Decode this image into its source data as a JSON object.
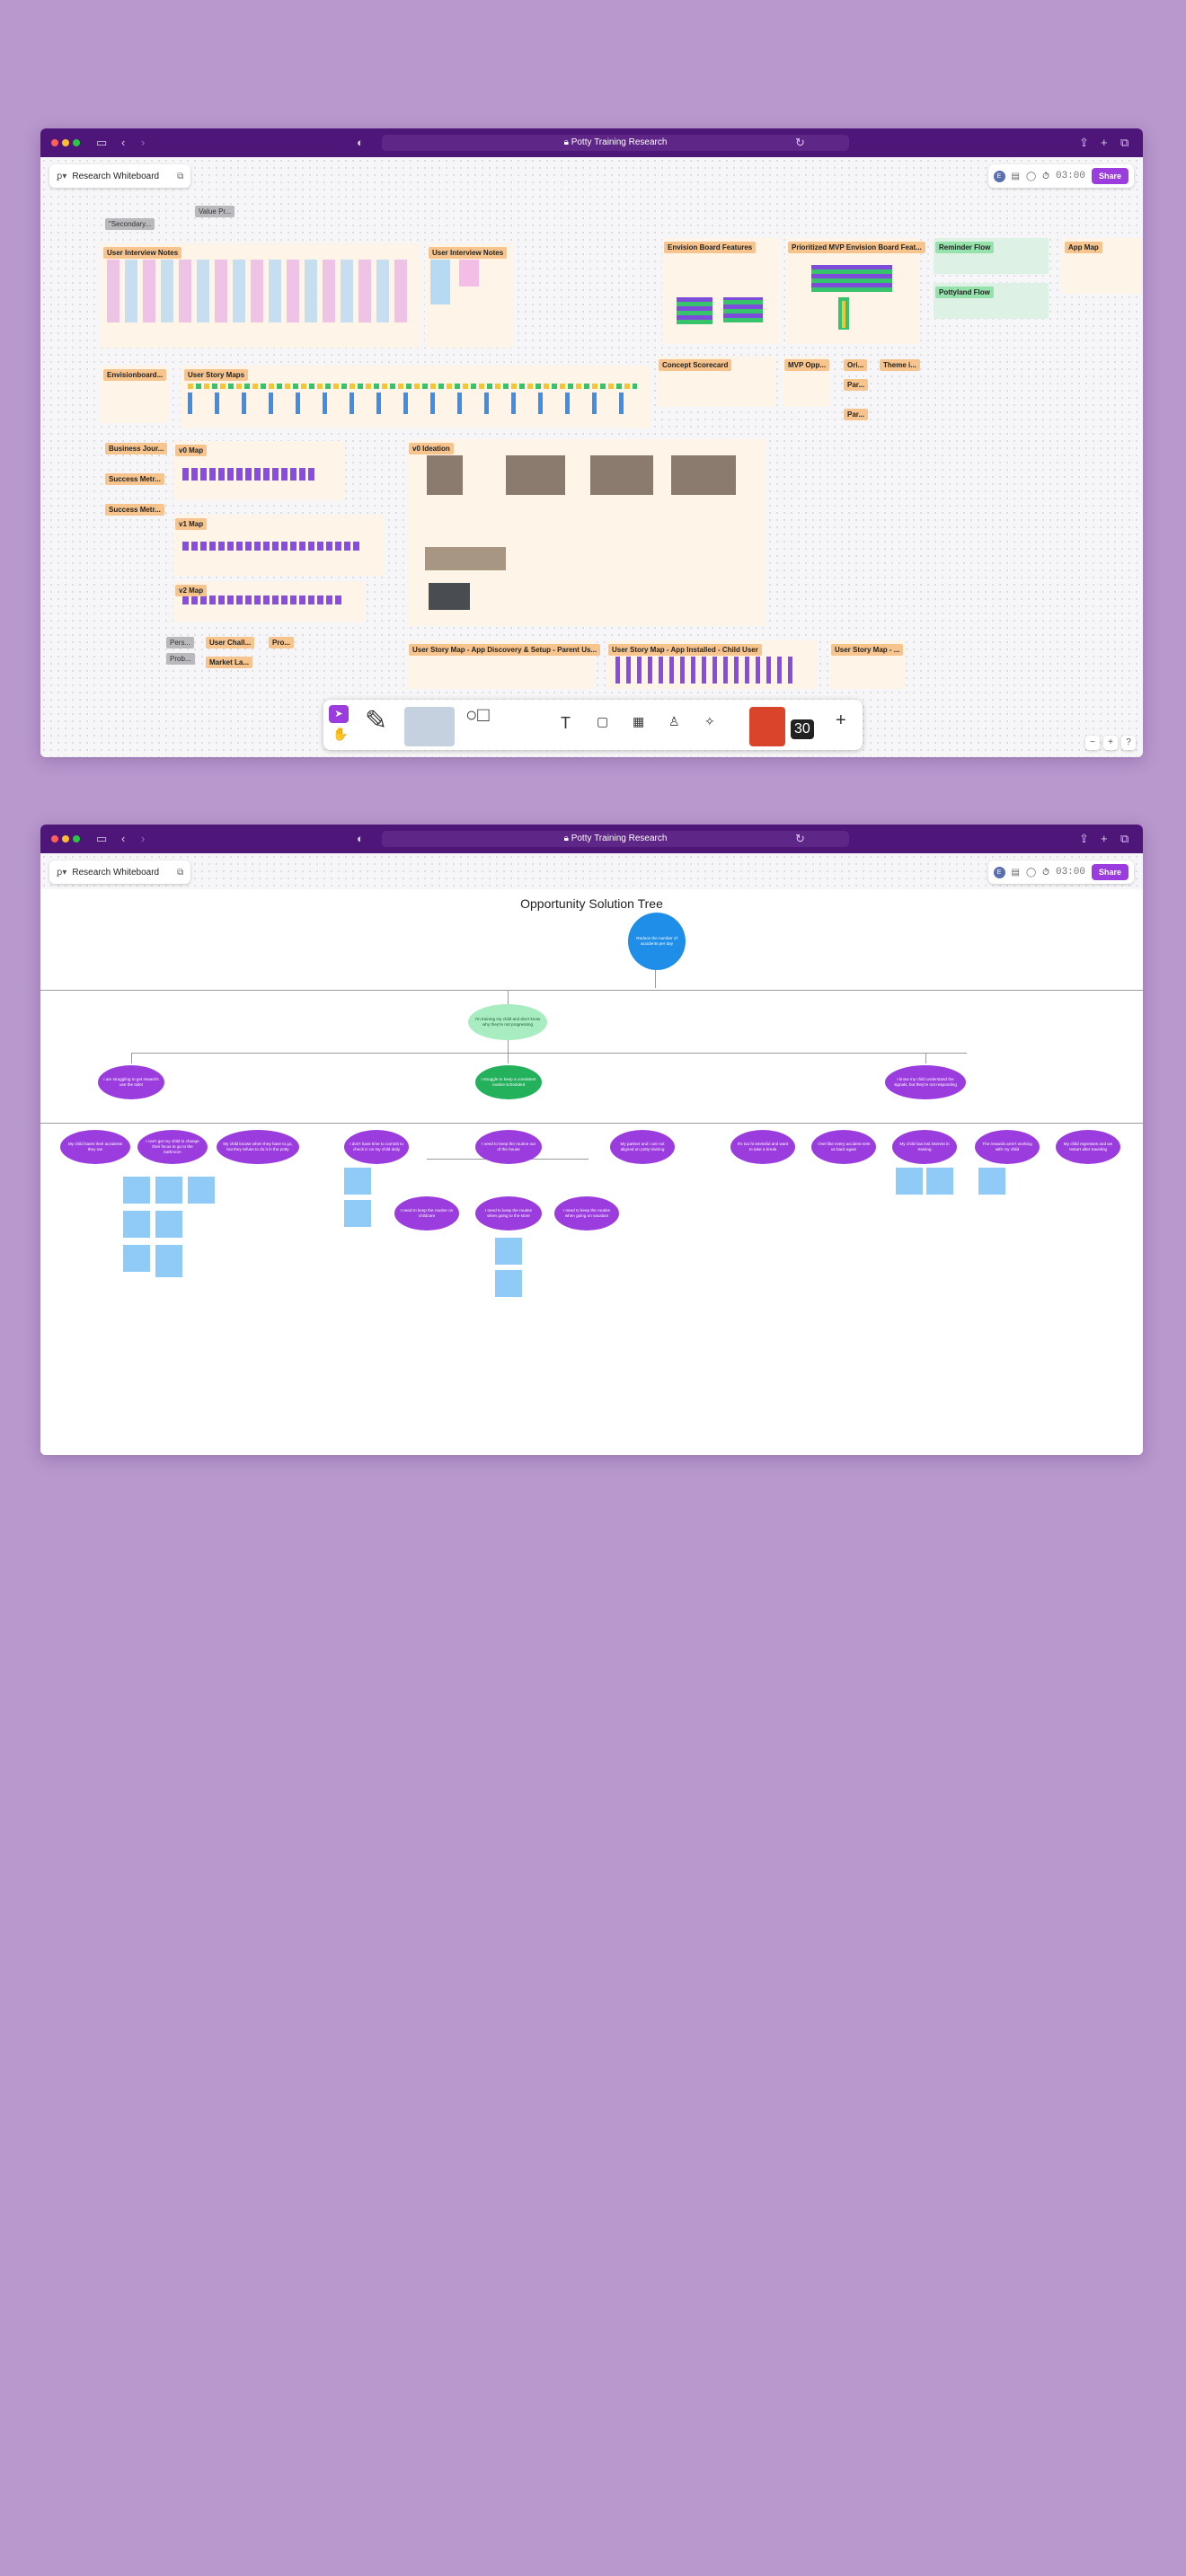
{
  "colors": {
    "background": "#b898cd",
    "titlebar": "#4d1678",
    "accent": "#9b3dde"
  },
  "window1": {
    "url": "Potty Training Research",
    "file_name": "Research Whiteboard",
    "avatar": "E",
    "timer": "03:00",
    "share": "Share",
    "sections": {
      "secondary": "\"Secondary...",
      "value_pr": "Value Pr...",
      "uin1": "User Interview Notes",
      "uin2": "User Interview Notes",
      "envision_feat": "Envision Board Features",
      "prio_mvp": "Prioritized MVP Envision Board Feat...",
      "reminder": "Reminder Flow",
      "pottyland": "Pottyland Flow",
      "appmap": "App Map",
      "envisionboard": "Envisionboard...",
      "usm": "User Story Maps",
      "concept": "Concept Scorecard",
      "mvp_opp": "MVP Opp...",
      "ori": "Ori...",
      "theme": "Theme i...",
      "par1": "Par...",
      "par2": "Par...",
      "business": "Business Jour...",
      "success1": "Success Metr...",
      "success2": "Success Metr...",
      "v0map": "v0 Map",
      "v1map": "v1 Map",
      "v2map": "v2 Map",
      "v0ideation": "v0 Ideation",
      "pers": "Pers...",
      "prob": "Prob...",
      "user_chall": "User Chall...",
      "market": "Market La...",
      "pro": "Pro...",
      "usm_parent": "User Story Map - App Discovery & Setup - Parent Us...",
      "usm_child": "User Story Map - App Installed - Child User",
      "usm_small": "User Story Map - ..."
    },
    "tools": {
      "select": "cursor-icon",
      "hand": "hand-icon",
      "text": "T",
      "plus": "+",
      "sticker_count": "30"
    },
    "zoom": {
      "minus": "−",
      "plus": "+",
      "help": "?"
    }
  },
  "window2": {
    "url": "Potty Training Research",
    "file_name": "Research Whiteboard",
    "avatar": "E",
    "timer": "03:00",
    "share": "Share",
    "ost": {
      "title": "Opportunity Solution Tree",
      "outcome": "Reduce the number of accidents per day",
      "root_opp": "I'm training my child and don't know why they're not progressing",
      "opp_left": "I am struggling to get reward's use the toilet",
      "opp_mid": "I struggle to keep a consistent routine scheduled",
      "opp_right": "I know my child understand the signals, but they're not responding",
      "left_children": [
        "My child hates their accidents they ran",
        "I can't get my child to change their focus to go to the bathroom",
        "My child knows when they have to go, but they refuse to do it in the potty"
      ],
      "mid_children": [
        "I don't have time to commit to check in on my child daily",
        "I need to keep the routine out of the house",
        "My partner and I are not aligned on potty training"
      ],
      "mid_grand": [
        "I need to keep the routine on childcare",
        "I need to keep the routine when going to the store",
        "I need to keep the routine when going on vacation"
      ],
      "right_children": [
        "It's too hi stressful and want to take a break",
        "I feel like every accident sets us back again",
        "My child has lost interest in training",
        "The rewards aren't working with my child",
        "My child regresses and we restart after traveling"
      ]
    }
  }
}
